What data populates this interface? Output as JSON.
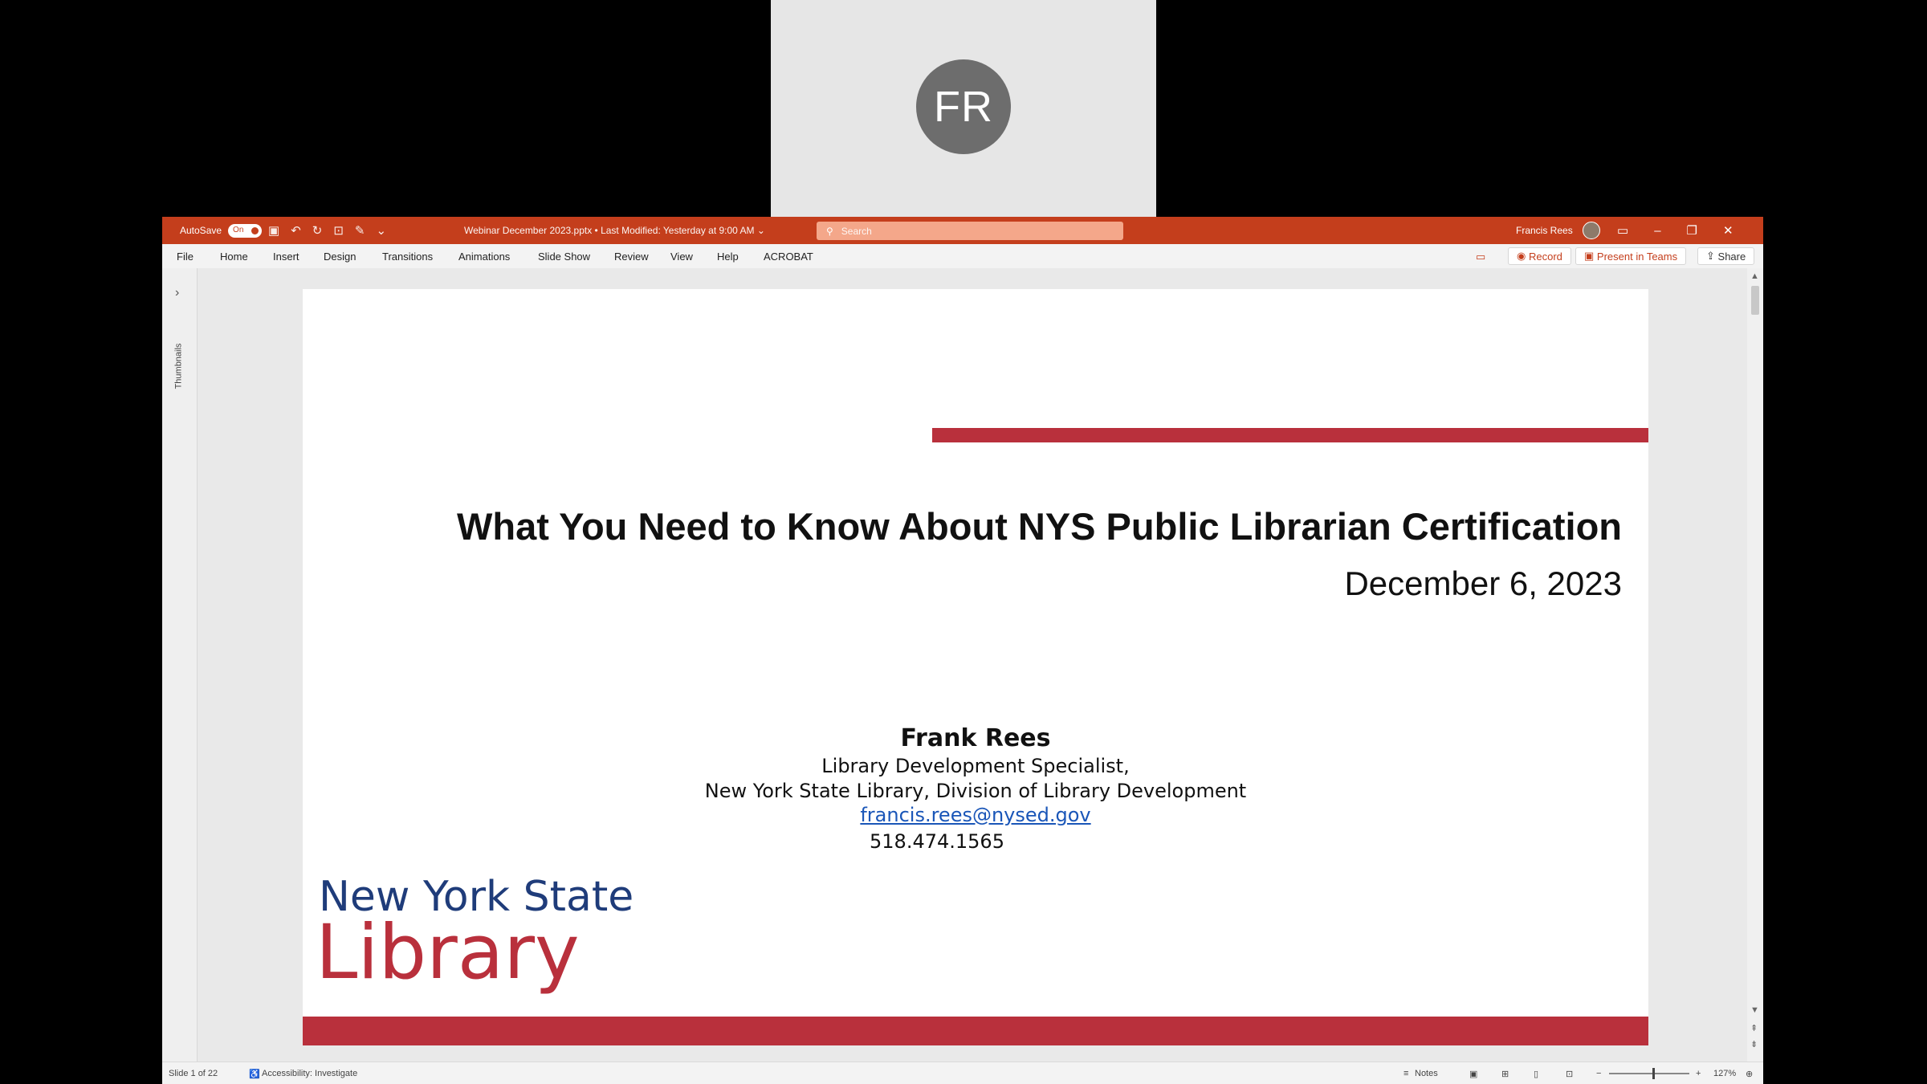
{
  "participant": {
    "initials": "FR"
  },
  "titlebar": {
    "autosave_label": "AutoSave",
    "autosave_state": "On",
    "document_title": "Webinar December 2023.pptx • Last Modified: Yesterday at 9:00 AM ⌄",
    "search_placeholder": "Search",
    "user_name": "Francis Rees",
    "brand_color": "#c43e1c"
  },
  "menu": {
    "items": [
      "File",
      "Home",
      "Insert",
      "Design",
      "Transitions",
      "Animations",
      "Slide Show",
      "Review",
      "View",
      "Help",
      "ACROBAT"
    ],
    "record_label": "Record",
    "present_label": "Present in Teams",
    "share_label": "Share"
  },
  "thumbnails_label": "Thumbnails",
  "slide": {
    "title": "What You Need to Know About NYS Public Librarian Certification",
    "date": "December 6, 2023",
    "presenter_name": "Frank Rees",
    "presenter_role": "Library Development Specialist,",
    "presenter_org": "New York State Library, Division of Library Development",
    "presenter_email": "francis.rees@nysed.gov",
    "presenter_phone": "518.474.1565",
    "logo_line1": "New York State",
    "logo_line2": "Library",
    "accent_color": "#b9303c",
    "logo_blue": "#1f3c7a"
  },
  "status": {
    "slide_counter": "Slide 1 of 22",
    "accessibility": "Accessibility: Investigate",
    "notes_label": "Notes",
    "zoom": "127%"
  }
}
